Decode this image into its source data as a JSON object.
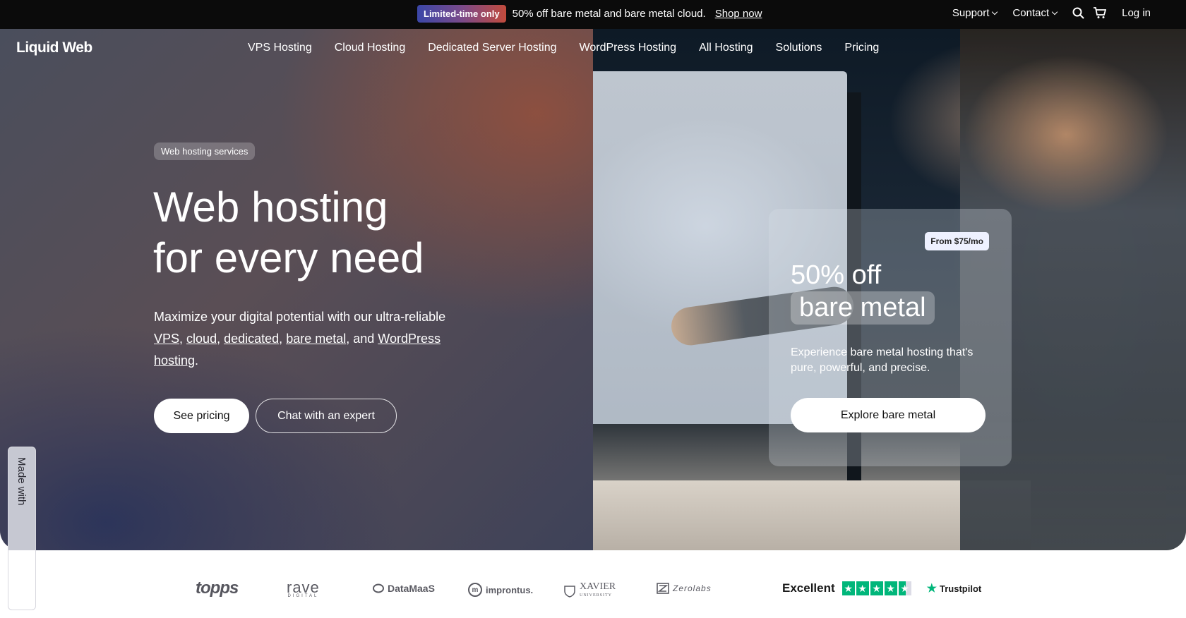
{
  "topbar": {
    "promo_badge": "Limited-time only",
    "promo_text": "50% off bare metal and bare metal cloud.",
    "promo_link": "Shop now",
    "support": "Support",
    "contact": "Contact",
    "login": "Log in"
  },
  "nav": {
    "logo": "Liquid Web",
    "links": [
      "VPS Hosting",
      "Cloud Hosting",
      "Dedicated Server Hosting",
      "WordPress Hosting",
      "All Hosting",
      "Solutions",
      "Pricing"
    ]
  },
  "hero": {
    "chip": "Web hosting services",
    "headline_line1": "Web hosting",
    "headline_line2": "for every need",
    "sub_prefix": "Maximize your digital potential with our ultra-reliable ",
    "sub_links": [
      "VPS",
      "cloud",
      "dedicated",
      "bare metal",
      "WordPress hosting"
    ],
    "sub_and": ", and ",
    "sub_end": ".",
    "primary_button": "See pricing",
    "secondary_button": "Chat with an expert"
  },
  "promo_card": {
    "badge": "From $75/mo",
    "title_line1": "50% off",
    "title_line2": "bare metal",
    "text": "Experience bare metal hosting that's pure, powerful, and precise.",
    "button": "Explore bare metal"
  },
  "made_with": {
    "label": "Made with"
  },
  "logos": {
    "items": [
      "topps",
      "rave",
      "DataMaaS",
      "improntus.",
      "XAVIER",
      "Zerolabs"
    ],
    "rave_sub": "DIGITAL",
    "xavier_sub": "UNIVERSITY"
  },
  "trustpilot": {
    "rating_text": "Excellent",
    "rating": 4.5,
    "brand": "Trustpilot"
  },
  "colors": {
    "topbar_bg": "#0b0b0b",
    "trustpilot_green": "#00b67a",
    "button_bg": "#ffffff"
  },
  "icons": {
    "search": "search-icon",
    "cart": "cart-icon",
    "chevron": "chevron-down-icon",
    "star": "star-icon"
  }
}
